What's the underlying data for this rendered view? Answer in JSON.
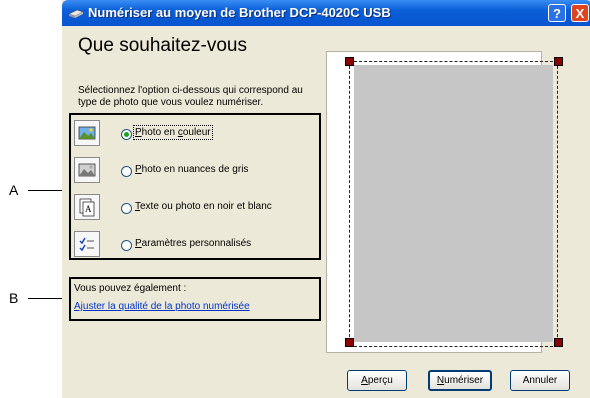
{
  "callouts": {
    "a": "A",
    "b": "B"
  },
  "window": {
    "title": "Numériser au moyen de Brother DCP-4020C USB",
    "help": "?",
    "close": "X"
  },
  "heading": "Que souhaitez-vous",
  "description": "Sélectionnez l'option ci-dessous qui correspond au type de photo que vous voulez numériser.",
  "options": [
    {
      "key": "color",
      "label_prefix": "",
      "label_hotkey": "P",
      "label_rest": "hoto en ",
      "label_hotkey2": "c",
      "label_rest2": "ouleur",
      "selected": true,
      "icon": "color-photo-icon"
    },
    {
      "key": "gray",
      "label_hotkey": "P",
      "label_rest": "hoto en nuances de gris",
      "selected": false,
      "icon": "grayscale-photo-icon"
    },
    {
      "key": "bw",
      "label_hotkey": "T",
      "label_rest": "exte ou photo en noir et blanc",
      "selected": false,
      "icon": "text-document-icon"
    },
    {
      "key": "custom",
      "label_hotkey": "P",
      "label_rest": "aramètres personnalisés",
      "selected": false,
      "icon": "custom-settings-icon"
    }
  ],
  "also": {
    "title": "Vous pouvez également :",
    "link": "Ajuster la qualité de la photo numérisée"
  },
  "buttons": {
    "preview_hotkey": "A",
    "preview_rest": "perçu",
    "scan_hotkey": "N",
    "scan_rest": "umériser",
    "cancel": "Annuler"
  },
  "colors": {
    "titlebar": "#0754cf",
    "dialog_bg": "#ece9d8",
    "link": "#0033cc",
    "handle": "#8b0000",
    "preview_gray": "#c6c6c6"
  }
}
